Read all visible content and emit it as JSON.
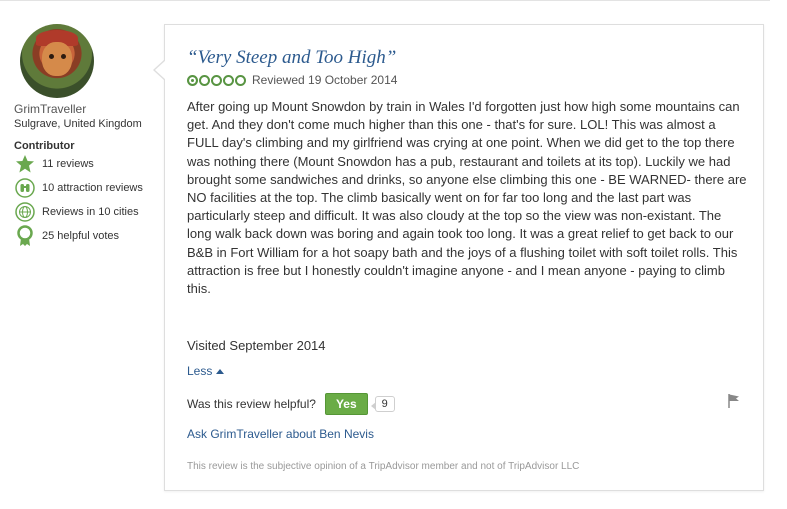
{
  "member": {
    "username": "GrimTraveller",
    "location": "Sulgrave, United Kingdom",
    "level_title": "Contributor",
    "stats": [
      {
        "icon": "star-icon",
        "text": "11 reviews"
      },
      {
        "icon": "binoculars-icon",
        "text": "10 attraction reviews"
      },
      {
        "icon": "globe-icon",
        "text": "Reviews in 10 cities"
      },
      {
        "icon": "award-ribbon-icon",
        "text": "25 helpful votes"
      }
    ]
  },
  "review": {
    "title": "“Very Steep and Too High”",
    "rating": 1,
    "rating_max": 5,
    "reviewed_date": "Reviewed 19 October 2014",
    "body": "After going up Mount Snowdon by train in Wales I'd forgotten just how high some mountains can get. And they don't come much higher than this one - that's for sure. LOL! This was almost a FULL day's climbing and my girlfriend was crying at one point. When we did get to the top there was nothing there (Mount Snowdon has a pub, restaurant and toilets at its top). Luckily we had brought some sandwiches and drinks, so anyone else climbing this one - BE WARNED- there are NO facilities at the top. The climb basically went on for far too long and the last part was particularly steep and difficult. It was also cloudy at the top so the view was non-existant. The long walk back down was boring and again took too long. It was a great relief to get back to our B&B in Fort William for a hot soapy bath and the joys of a flushing toilet with soft toilet rolls. This attraction is free but I honestly couldn't imagine anyone - and I mean anyone - paying to climb this.",
    "visited": "Visited September 2014",
    "less_label": "Less",
    "helpful_question": "Was this review helpful?",
    "yes_label": "Yes",
    "helpful_count": "9",
    "ask_link": "Ask GrimTraveller about Ben Nevis",
    "disclaimer": "This review is the subjective opinion of a TripAdvisor member and not of TripAdvisor LLC"
  },
  "colors": {
    "link": "#2c5a8e",
    "rating_green": "#589442",
    "yes_button": "#6aac46",
    "badge_green": "#6aa84f"
  }
}
